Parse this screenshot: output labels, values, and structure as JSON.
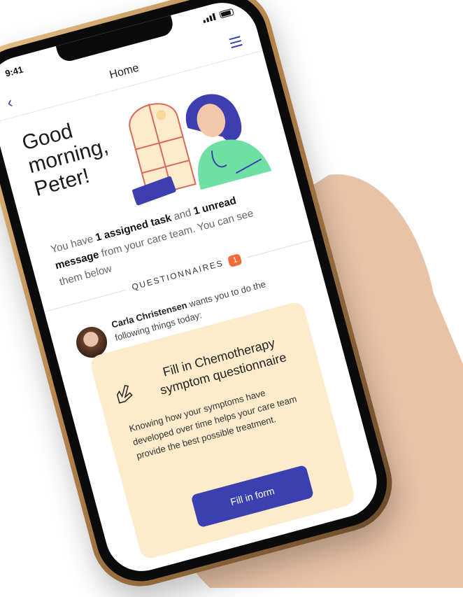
{
  "status_bar": {
    "time": "9:41"
  },
  "navbar": {
    "title": "Home",
    "back_icon": "chevron-left-icon",
    "menu_icon": "hamburger-menu-icon"
  },
  "greeting": "Good morning, Peter!",
  "intro": {
    "part1": "You have ",
    "bold1": "1 assigned task",
    "part2": " and ",
    "bold2": "1 unread message",
    "part3": " from your care team. You can see them below"
  },
  "section": {
    "title": "QUESTIONNAIRES",
    "count": "1"
  },
  "sender": {
    "name": "Carla Christensen",
    "text": " wants you to do the following things today:"
  },
  "task_card": {
    "icon": "hand-pen-icon",
    "title": "Fill in Chemotherapy symptom questionnaire",
    "description": "Knowing how your symptoms have developed over time helps your care team provide the best possible treatment.",
    "button_label": "Fill in form"
  },
  "colors": {
    "accent": "#3b40b0",
    "card_bg": "#fdebcb",
    "badge": "#f26b3a",
    "nurse_top": "#6ee0a4",
    "nurse_hair": "#3d3fb0"
  }
}
